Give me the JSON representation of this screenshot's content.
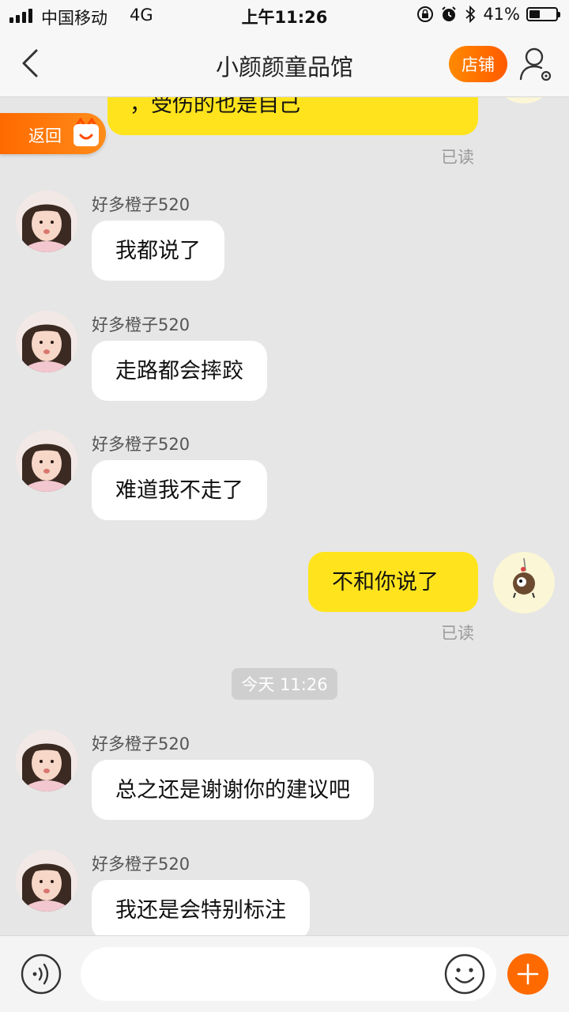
{
  "status_bar": {
    "carrier": "中国移动",
    "network": "4G",
    "time": "上午11:26",
    "battery_text": "41%",
    "battery_level": 0.41
  },
  "nav": {
    "title": "小颜颜童品馆",
    "shop_label": "店铺"
  },
  "back_pill": {
    "label": "返回"
  },
  "messages": [
    {
      "side": "right",
      "text": "，受伤的也是自己",
      "status": "已读"
    },
    {
      "side": "left",
      "sender": "好多橙子520",
      "text": "我都说了"
    },
    {
      "side": "left",
      "sender": "好多橙子520",
      "text": "走路都会摔跤"
    },
    {
      "side": "left",
      "sender": "好多橙子520",
      "text": "难道我不走了"
    },
    {
      "side": "right",
      "text": "不和你说了",
      "status": "已读"
    },
    {
      "side": "time",
      "text": "今天 11:26"
    },
    {
      "side": "left",
      "sender": "好多橙子520",
      "text": "总之还是谢谢你的建议吧"
    },
    {
      "side": "left",
      "sender": "好多橙子520",
      "text": "我还是会特别标注"
    }
  ],
  "input": {
    "placeholder": ""
  },
  "icons": {
    "back": "chevron-left-icon",
    "person": "person-settings-icon",
    "voice": "voice-icon",
    "emoji": "emoji-icon",
    "plus": "plus-icon"
  },
  "colors": {
    "accent": "#ff6a00",
    "own_bubble": "#ffe41d",
    "other_bubble": "#ffffff",
    "background": "#e6e6e6"
  }
}
